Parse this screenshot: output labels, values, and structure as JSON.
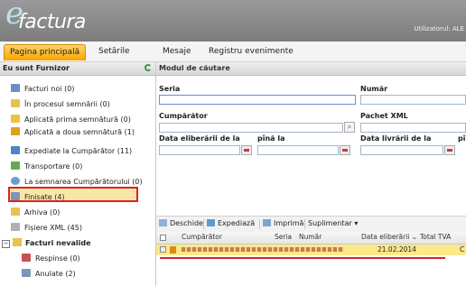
{
  "app": {
    "logo_letter": "e",
    "logo_text": "factura",
    "user_label": "Utilizatorul: ALE"
  },
  "nav": {
    "tabs": [
      {
        "label": "Pagina principală",
        "active": true
      },
      {
        "label": "Setările",
        "active": false
      },
      {
        "label": "Mesaje",
        "active": false
      },
      {
        "label": "Registru evenimente",
        "active": false
      }
    ]
  },
  "sidebar": {
    "header": "Eu sunt Furnizor",
    "refresh_icon": "refresh-icon",
    "items": [
      {
        "label": "Facturi noi (0)",
        "icon": "document-icon",
        "color": "#6b8fc4"
      },
      {
        "label": "În procesul semnării (0)",
        "icon": "folder-icon",
        "color": "#e8c150"
      },
      {
        "label": "Aplicată prima semnătură (0)",
        "icon": "page-icon",
        "color": "#f0c040"
      },
      {
        "label": "Aplicată a doua semnătură (1)",
        "icon": "page-icon",
        "color": "#e0a020"
      },
      {
        "label": "Expediate la Cumpărător (11)",
        "icon": "send-icon",
        "color": "#4c86c8"
      },
      {
        "label": "Transportare (0)",
        "icon": "truck-icon",
        "color": "#6aa84f"
      },
      {
        "label": "La semnarea Cumpărătorului (0)",
        "icon": "clock-icon",
        "color": "#6a9ed6"
      },
      {
        "label": "Finisate (4)",
        "icon": "document-icon",
        "color": "#7e94b8"
      },
      {
        "label": "Arhiva (0)",
        "icon": "folder-icon",
        "color": "#e8c150"
      },
      {
        "label": "Fișiere XML (45)",
        "icon": "xml-icon",
        "color": "#b0b0b0"
      }
    ],
    "group": {
      "label": "Facturi nevalide",
      "icon": "folder-icon"
    },
    "sub_items": [
      {
        "label": "Respinse (0)",
        "icon": "rejected-icon",
        "color": "#c45252"
      },
      {
        "label": "Anulate (2)",
        "icon": "cancelled-icon",
        "color": "#7e94b8"
      }
    ]
  },
  "search": {
    "header": "Modul de căutare",
    "seria_label": "Seria",
    "numar_label": "Număr",
    "cumparator_label": "Cumpărător",
    "pachet_label": "Pachet XML",
    "data_elib_label": "Data eliberării de la",
    "pana_la_label": "pînă la",
    "data_livr_label": "Data livrării de la",
    "data_livr_pana_label": "pî"
  },
  "toolbar": {
    "open": "Deschide",
    "send": "Expediază",
    "print": "Imprimă",
    "extra": "Suplimentar ▾"
  },
  "grid": {
    "columns": [
      "Cumpărător",
      "Seria",
      "Număr",
      "Data eliberării ⌄",
      "Total TVA"
    ],
    "rows": [
      {
        "date": "21.02.2014",
        "extra": "C"
      }
    ]
  }
}
